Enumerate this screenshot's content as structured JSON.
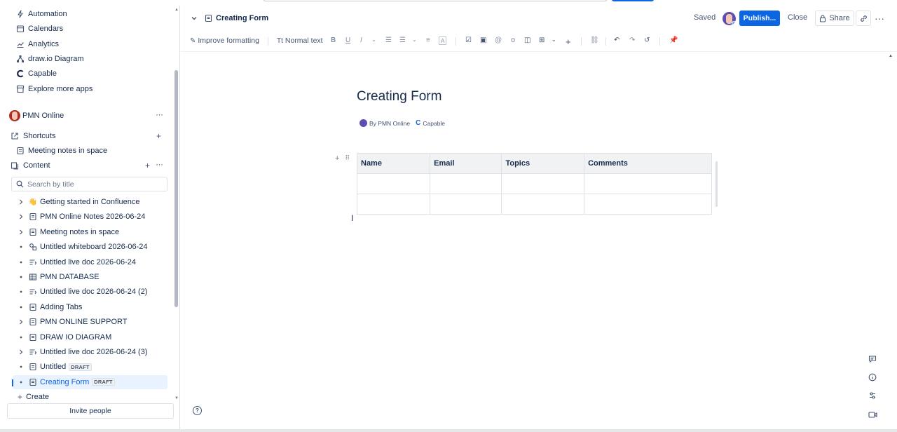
{
  "sidebar": {
    "apps": [
      {
        "label": "Automation",
        "icon": "lightning-icon"
      },
      {
        "label": "Calendars",
        "icon": "calendar-icon"
      },
      {
        "label": "Analytics",
        "icon": "chart-line-icon"
      },
      {
        "label": "draw.io Diagram",
        "icon": "drawio-icon"
      },
      {
        "label": "Capable",
        "icon": "capable-icon"
      },
      {
        "label": "Explore more apps",
        "icon": "apps-store-icon"
      }
    ],
    "space_name": "PMN Online",
    "shortcuts_label": "Shortcuts",
    "shortcut_items": [
      {
        "label": "Meeting notes in space"
      }
    ],
    "content_label": "Content",
    "search_placeholder": "Search by title",
    "tree": [
      {
        "label": "Getting started in Confluence",
        "icon": "emoji-icon",
        "expand": "chevron"
      },
      {
        "label": "PMN Online Notes 2026-06-24",
        "icon": "page-icon",
        "expand": "chevron"
      },
      {
        "label": "Meeting notes in space",
        "icon": "page-icon",
        "expand": "chevron"
      },
      {
        "label": "Untitled whiteboard 2026-06-24",
        "icon": "whiteboard-icon",
        "expand": "dot"
      },
      {
        "label": "Untitled live doc 2026-06-24",
        "icon": "live-doc-icon",
        "expand": "dot"
      },
      {
        "label": "PMN DATABASE",
        "icon": "database-icon",
        "expand": "dot"
      },
      {
        "label": "Untitled live doc 2026-06-24 (2)",
        "icon": "live-doc-icon",
        "expand": "dot"
      },
      {
        "label": "Adding Tabs",
        "icon": "page-icon",
        "expand": "dot"
      },
      {
        "label": "PMN ONLINE SUPPORT",
        "icon": "page-icon",
        "expand": "chevron"
      },
      {
        "label": "DRAW IO DIAGRAM",
        "icon": "page-icon",
        "expand": "dot"
      },
      {
        "label": "Untitled live doc 2026-06-24 (3)",
        "icon": "live-doc-icon",
        "expand": "chevron"
      },
      {
        "label": "Untitled",
        "icon": "page-icon",
        "expand": "dot",
        "badge": "DRAFT"
      },
      {
        "label": "Creating Form",
        "icon": "page-icon",
        "expand": "dot",
        "badge": "DRAFT",
        "active": true
      }
    ],
    "create_label": "Create",
    "invite_label": "Invite people"
  },
  "header": {
    "title": "Creating Form",
    "saved_label": "Saved",
    "publish_label": "Publish...",
    "close_label": "Close",
    "share_label": "Share"
  },
  "toolbar": {
    "improve_label": "Improve formatting",
    "text_style_label": "Normal text"
  },
  "page": {
    "title": "Creating Form",
    "byline": "By PMN Online",
    "app_label": "Capable",
    "table": {
      "headers": [
        "Name",
        "Email",
        "Topics",
        "Comments"
      ],
      "rows": [
        [
          "",
          "",
          "",
          ""
        ],
        [
          "",
          "",
          "",
          ""
        ]
      ]
    }
  },
  "colors": {
    "accent": "#0c66e4",
    "active_bg": "#e9f2ff",
    "header_bg": "#f1f2f4"
  }
}
